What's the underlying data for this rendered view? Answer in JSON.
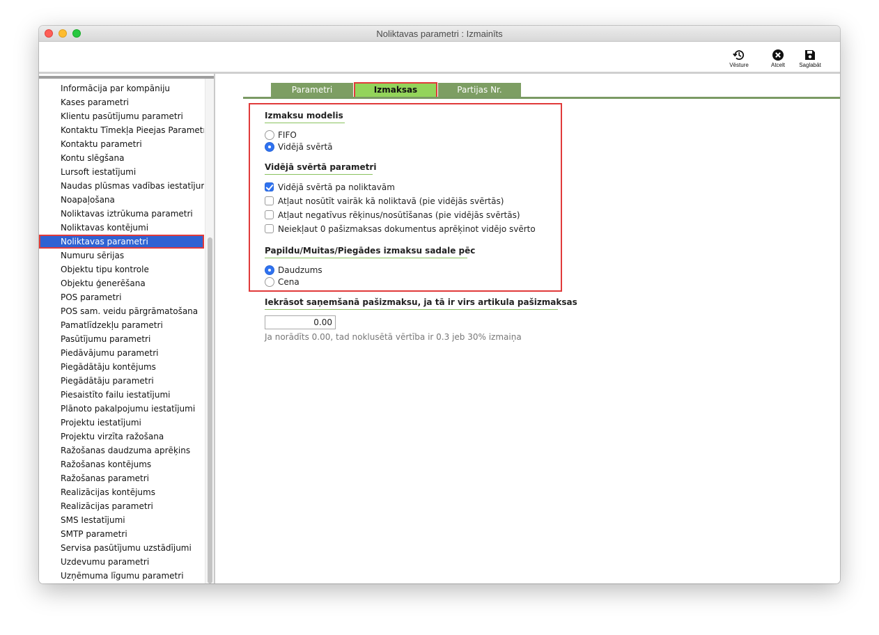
{
  "window": {
    "title": "Noliktavas parametri : Izmainīts"
  },
  "toolbar": {
    "history_label": "Vēsture",
    "cancel_label": "Atcelt",
    "save_label": "Saglabāt"
  },
  "sidebar": {
    "items": [
      "Informācija par kompāniju",
      "Kases parametri",
      "Klientu pasūtījumu parametri",
      "Kontaktu Tīmekļa Pieejas Parametri",
      "Kontaktu parametri",
      "Kontu slēgšana",
      "Lursoft iestatījumi",
      "Naudas plūsmas vadības iestatījumi",
      "Noapaļošana",
      "Noliktavas iztrūkuma parametri",
      "Noliktavas kontējumi",
      "Noliktavas parametri",
      "Numuru sērijas",
      "Objektu tipu kontrole",
      "Objektu ģenerēšana",
      "POS parametri",
      "POS sam. veidu pārgrāmatošana",
      "Pamatlīdzekļu parametri",
      "Pasūtījumu parametri",
      "Piedāvājumu parametri",
      "Piegādātāju kontējums",
      "Piegādātāju parametri",
      "Piesaistīto failu iestatījumi",
      "Plānoto pakalpojumu iestatījumi",
      "Projektu iestatījumi",
      "Projektu virzīta ražošana",
      "Ražošanas daudzuma aprēķins",
      "Ražošanas kontējums",
      "Ražošanas parametri",
      "Realizācijas kontējums",
      "Realizācijas parametri",
      "SMS Iestatījumi",
      "SMTP parametri",
      "Servisa pasūtījumu uzstādījumi",
      "Uzdevumu parametri",
      "Uzņēmuma līgumu parametri"
    ],
    "selected_index": 11
  },
  "tabs": [
    {
      "label": "Parametri",
      "active": false
    },
    {
      "label": "Izmaksas",
      "active": true
    },
    {
      "label": "Partijas Nr.",
      "active": false
    }
  ],
  "cost_model": {
    "title": "Izmaksu modelis",
    "options": [
      {
        "label": "FIFO",
        "selected": false
      },
      {
        "label": "Vidējā svērtā",
        "selected": true
      }
    ]
  },
  "weighted_params": {
    "title": "Vidējā svērtā parametri",
    "checks": [
      {
        "label": "Vidējā svērtā pa noliktavām",
        "checked": true
      },
      {
        "label": "Atļaut nosūtīt vairāk kā noliktavā (pie vidējās svērtās)",
        "checked": false
      },
      {
        "label": "Atļaut negatīvus rēķinus/nosūtīšanas (pie vidējās svērtās)",
        "checked": false
      },
      {
        "label": "Neiekļaut 0 pašizmaksas dokumentus aprēķinot vidējo svērto",
        "checked": false
      }
    ]
  },
  "distribution": {
    "title": "Papildu/Muitas/Piegādes izmaksu sadale pēc",
    "options": [
      {
        "label": "Daudzums",
        "selected": true
      },
      {
        "label": "Cena",
        "selected": false
      }
    ]
  },
  "threshold": {
    "title": "Iekrāsot saņemšanā pašizmaksu, ja tā ir virs artikula pašizmaksas",
    "value": "0.00",
    "hint": "Ja norādīts 0.00, tad noklusētā vērtība ir 0.3 jeb 30% izmaiņa"
  },
  "colors": {
    "tab": "#7d9e63",
    "tab_active": "#93d45a",
    "selection": "#2f62d3",
    "highlight": "#e03a3a"
  },
  "icons": {
    "history": "history-icon",
    "cancel": "close-circle-icon",
    "save": "floppy-disk-icon"
  }
}
